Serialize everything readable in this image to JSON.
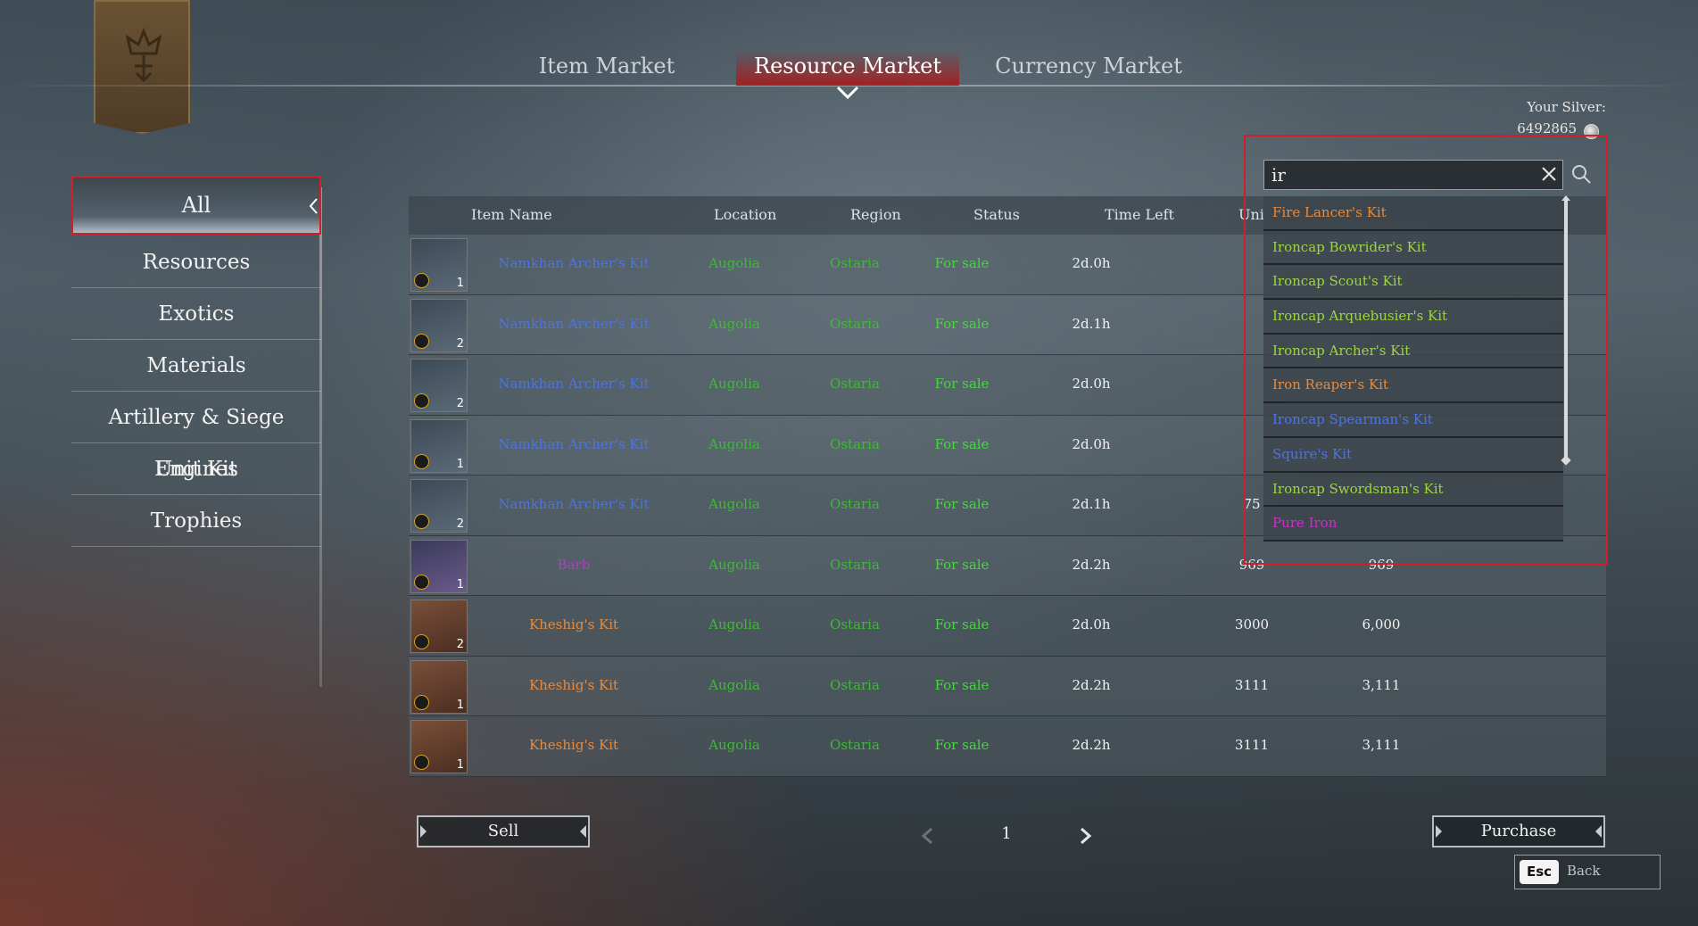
{
  "tabs": [
    {
      "label": "Item Market"
    },
    {
      "label": "Resource Market"
    },
    {
      "label": "Currency Market"
    }
  ],
  "silver": {
    "label": "Your Silver:",
    "value": "6492865"
  },
  "categories": [
    {
      "label": "All"
    },
    {
      "label": "Resources"
    },
    {
      "label": "Exotics"
    },
    {
      "label": "Materials"
    },
    {
      "label": "Artillery & Siege Engines"
    },
    {
      "label": "Unit Kit"
    },
    {
      "label": "Trophies"
    }
  ],
  "table": {
    "headers": {
      "name": "Item Name",
      "location": "Location",
      "region": "Region",
      "status": "Status",
      "time_left": "Time Left",
      "unit": "Uni"
    },
    "rows": [
      {
        "qty": "1",
        "name": "Namkhan Archer's Kit",
        "location": "Augolia",
        "region": "Ostaria",
        "status": "For sale",
        "time_left": "2d.0h",
        "unit": "",
        "total": ""
      },
      {
        "qty": "2",
        "name": "Namkhan Archer's Kit",
        "location": "Augolia",
        "region": "Ostaria",
        "status": "For sale",
        "time_left": "2d.1h",
        "unit": "",
        "total": ""
      },
      {
        "qty": "2",
        "name": "Namkhan Archer's Kit",
        "location": "Augolia",
        "region": "Ostaria",
        "status": "For sale",
        "time_left": "2d.0h",
        "unit": "",
        "total": ""
      },
      {
        "qty": "1",
        "name": "Namkhan Archer's Kit",
        "location": "Augolia",
        "region": "Ostaria",
        "status": "For sale",
        "time_left": "2d.0h",
        "unit": "",
        "total": ""
      },
      {
        "qty": "2",
        "name": "Namkhan Archer's Kit",
        "location": "Augolia",
        "region": "Ostaria",
        "status": "For sale",
        "time_left": "2d.1h",
        "unit": "75",
        "total": ""
      },
      {
        "qty": "1",
        "name": "Barb",
        "location": "Augolia",
        "region": "Ostaria",
        "status": "For sale",
        "time_left": "2d.2h",
        "unit": "969",
        "total": "969"
      },
      {
        "qty": "2",
        "name": "Kheshig's Kit",
        "location": "Augolia",
        "region": "Ostaria",
        "status": "For sale",
        "time_left": "2d.0h",
        "unit": "3000",
        "total": "6,000"
      },
      {
        "qty": "1",
        "name": "Kheshig's Kit",
        "location": "Augolia",
        "region": "Ostaria",
        "status": "For sale",
        "time_left": "2d.2h",
        "unit": "3111",
        "total": "3,111"
      },
      {
        "qty": "1",
        "name": "Kheshig's Kit",
        "location": "Augolia",
        "region": "Ostaria",
        "status": "For sale",
        "time_left": "2d.2h",
        "unit": "3111",
        "total": "3,111"
      }
    ]
  },
  "search": {
    "value": "ir",
    "results": [
      {
        "label": "Fire Lancer's Kit",
        "color": "#e88a3c"
      },
      {
        "label": "Ironcap Bowrider's Kit",
        "color": "#9dd63c"
      },
      {
        "label": "Ironcap Scout's Kit",
        "color": "#9dd63c"
      },
      {
        "label": "Ironcap Arquebusier's Kit",
        "color": "#9dd63c"
      },
      {
        "label": "Ironcap Archer's Kit",
        "color": "#9dd63c"
      },
      {
        "label": "Iron Reaper's Kit",
        "color": "#e88a3c"
      },
      {
        "label": "Ironcap Spearman's Kit",
        "color": "#4d74e0"
      },
      {
        "label": "Squire's Kit",
        "color": "#4d74e0"
      },
      {
        "label": "Ironcap Swordsman's Kit",
        "color": "#9dd63c"
      },
      {
        "label": "Pure Iron",
        "color": "#d02cd0"
      }
    ]
  },
  "footer": {
    "sell_label": "Sell",
    "purchase_label": "Purchase",
    "page_number": "1",
    "esc_key": "Esc",
    "back_label": "Back"
  },
  "icons": {
    "banner": "crown-emblem-icon",
    "clear": "close-icon",
    "search": "search-icon",
    "prev": "chevron-left-icon",
    "next": "chevron-right-icon",
    "coin": "silver-coin-icon"
  }
}
